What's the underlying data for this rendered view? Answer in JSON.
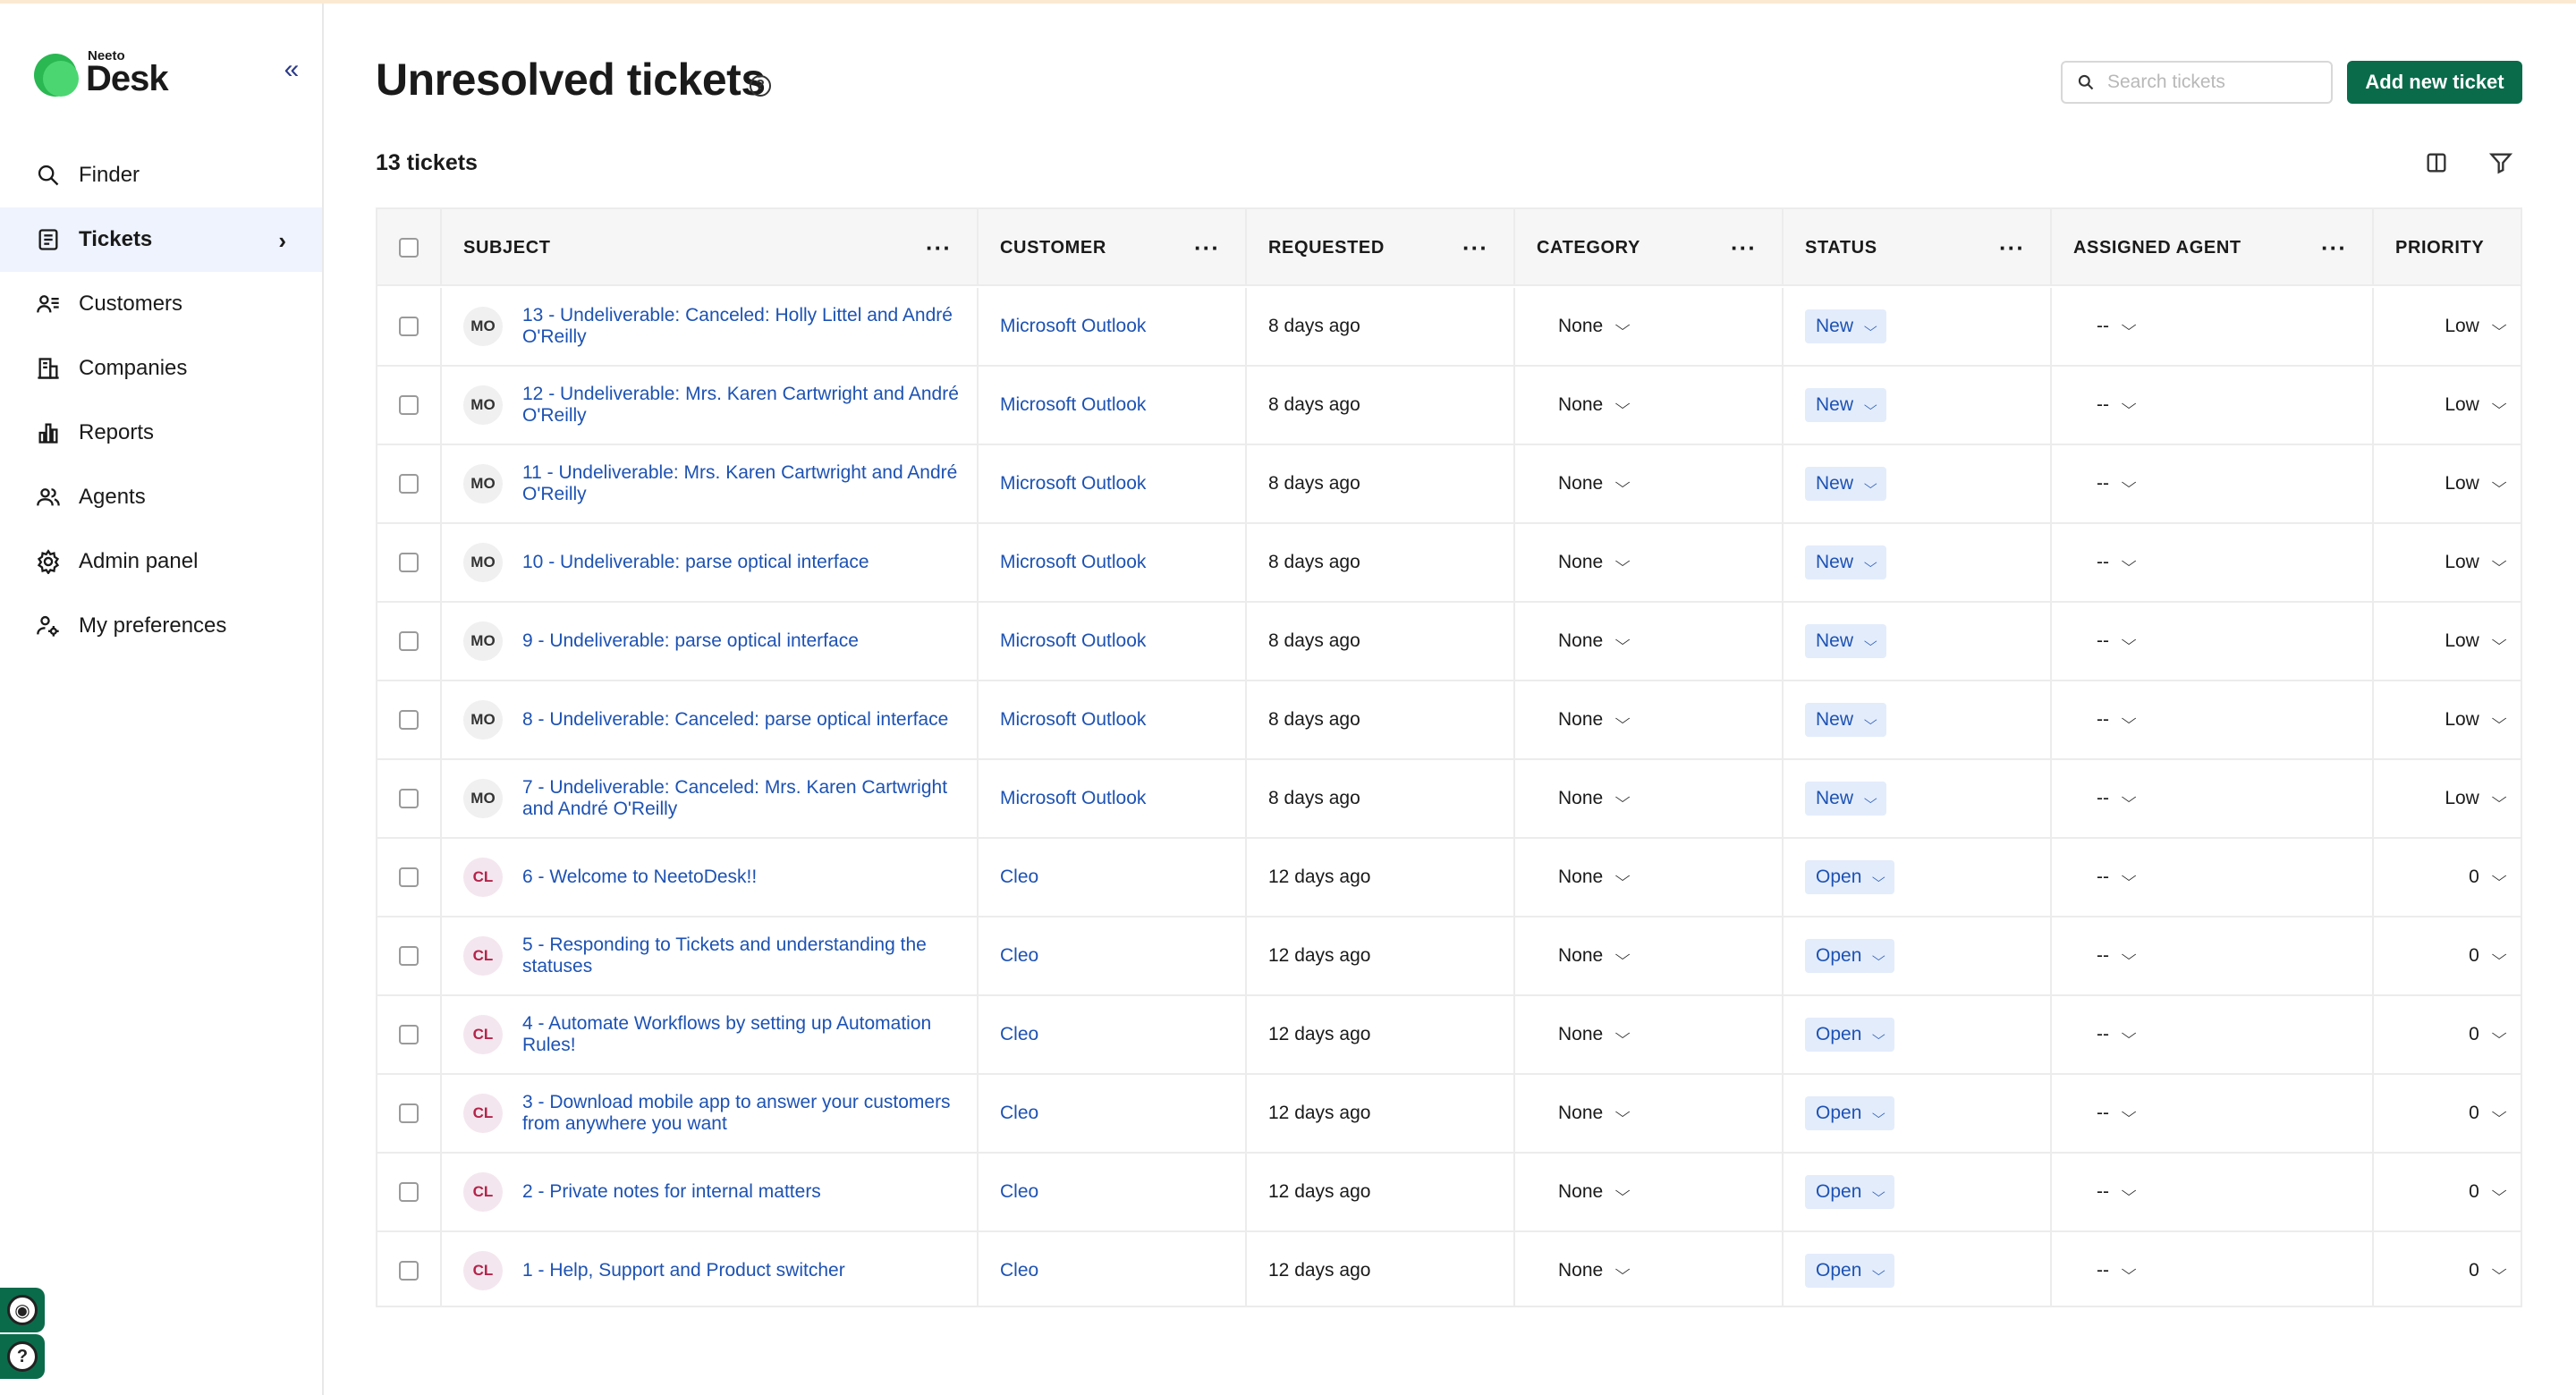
{
  "brand": {
    "top": "Neeto",
    "name": "Desk"
  },
  "sidebar": {
    "items": [
      {
        "label": "Finder",
        "icon": "search-icon"
      },
      {
        "label": "Tickets",
        "icon": "tickets-icon",
        "active": true
      },
      {
        "label": "Customers",
        "icon": "customers-icon"
      },
      {
        "label": "Companies",
        "icon": "companies-icon"
      },
      {
        "label": "Reports",
        "icon": "reports-icon"
      },
      {
        "label": "Agents",
        "icon": "agents-icon"
      },
      {
        "label": "Admin panel",
        "icon": "gear-icon"
      },
      {
        "label": "My preferences",
        "icon": "user-settings-icon"
      }
    ]
  },
  "header": {
    "title": "Unresolved tickets",
    "search_placeholder": "Search tickets",
    "add_button": "Add new ticket",
    "count_label": "13 tickets"
  },
  "table": {
    "columns": [
      "SUBJECT",
      "CUSTOMER",
      "REQUESTED",
      "CATEGORY",
      "STATUS",
      "ASSIGNED AGENT",
      "PRIORITY"
    ],
    "rows": [
      {
        "avatar": "MO",
        "subject": "13 - Undeliverable: Canceled: Holly Littel and André O'Reilly",
        "customer": "Microsoft Outlook",
        "requested": "8 days ago",
        "category": "None",
        "status": "New",
        "agent": "--",
        "priority": "Low"
      },
      {
        "avatar": "MO",
        "subject": "12 - Undeliverable: Mrs. Karen Cartwright and André O'Reilly",
        "customer": "Microsoft Outlook",
        "requested": "8 days ago",
        "category": "None",
        "status": "New",
        "agent": "--",
        "priority": "Low"
      },
      {
        "avatar": "MO",
        "subject": "11 - Undeliverable: Mrs. Karen Cartwright and André O'Reilly",
        "customer": "Microsoft Outlook",
        "requested": "8 days ago",
        "category": "None",
        "status": "New",
        "agent": "--",
        "priority": "Low"
      },
      {
        "avatar": "MO",
        "subject": "10 - Undeliverable: parse optical interface",
        "customer": "Microsoft Outlook",
        "requested": "8 days ago",
        "category": "None",
        "status": "New",
        "agent": "--",
        "priority": "Low"
      },
      {
        "avatar": "MO",
        "subject": "9 - Undeliverable: parse optical interface",
        "customer": "Microsoft Outlook",
        "requested": "8 days ago",
        "category": "None",
        "status": "New",
        "agent": "--",
        "priority": "Low"
      },
      {
        "avatar": "MO",
        "subject": "8 - Undeliverable: Canceled: parse optical interface",
        "customer": "Microsoft Outlook",
        "requested": "8 days ago",
        "category": "None",
        "status": "New",
        "agent": "--",
        "priority": "Low"
      },
      {
        "avatar": "MO",
        "subject": "7 - Undeliverable: Canceled: Mrs. Karen Cartwright and André O'Reilly",
        "customer": "Microsoft Outlook",
        "requested": "8 days ago",
        "category": "None",
        "status": "New",
        "agent": "--",
        "priority": "Low"
      },
      {
        "avatar": "CL",
        "subject": "6 - Welcome to NeetoDesk!!",
        "customer": "Cleo",
        "requested": "12 days ago",
        "category": "None",
        "status": "Open",
        "agent": "--",
        "priority": "0"
      },
      {
        "avatar": "CL",
        "subject": "5 - Responding to Tickets and understanding the statuses",
        "customer": "Cleo",
        "requested": "12 days ago",
        "category": "None",
        "status": "Open",
        "agent": "--",
        "priority": "0"
      },
      {
        "avatar": "CL",
        "subject": "4 - Automate Workflows by setting up Automation Rules!",
        "customer": "Cleo",
        "requested": "12 days ago",
        "category": "None",
        "status": "Open",
        "agent": "--",
        "priority": "0"
      },
      {
        "avatar": "CL",
        "subject": "3 - Download mobile app to answer your customers from anywhere you want",
        "customer": "Cleo",
        "requested": "12 days ago",
        "category": "None",
        "status": "Open",
        "agent": "--",
        "priority": "0"
      },
      {
        "avatar": "CL",
        "subject": "2 - Private notes for internal matters",
        "customer": "Cleo",
        "requested": "12 days ago",
        "category": "None",
        "status": "Open",
        "agent": "--",
        "priority": "0"
      },
      {
        "avatar": "CL",
        "subject": "1 - Help, Support and Product switcher",
        "customer": "Cleo",
        "requested": "12 days ago",
        "category": "None",
        "status": "Open",
        "agent": "--",
        "priority": "0"
      }
    ]
  },
  "colors": {
    "brand_green": "#0a6b4b",
    "link_blue": "#1d52b3",
    "status_bg": "#e3ecfb"
  }
}
